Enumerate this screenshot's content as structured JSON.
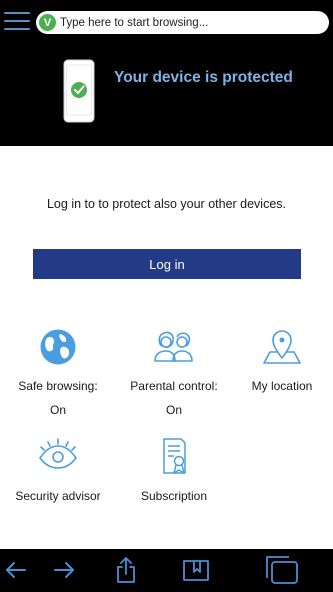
{
  "address_bar": {
    "placeholder": "Type here to start browsing...",
    "status_glyph": "V"
  },
  "status": {
    "title": "Your device is protected",
    "icon": "phone-checkmark-icon"
  },
  "login": {
    "message": "Log in to to protect also your other devices.",
    "button_label": "Log in"
  },
  "features": [
    {
      "label": "Safe browsing:",
      "status": "On",
      "icon": "globe-icon"
    },
    {
      "label": "Parental control:",
      "status": "On",
      "icon": "parents-icon"
    },
    {
      "label": "My location",
      "status": "",
      "icon": "location-pin-icon"
    },
    {
      "label": "Security advisor",
      "status": "",
      "icon": "eye-icon"
    },
    {
      "label": "Subscription",
      "status": "",
      "icon": "certificate-icon"
    }
  ],
  "toolbar": {
    "items": [
      "back-arrow-icon",
      "forward-arrow-icon",
      "share-icon",
      "bookmarks-icon",
      "tabs-icon"
    ]
  },
  "colors": {
    "accent": "#7db3e6",
    "icon_blue": "#4a9ee0",
    "button": "#233b86",
    "header_bg": "#000000",
    "shield_green": "#4caf50"
  }
}
